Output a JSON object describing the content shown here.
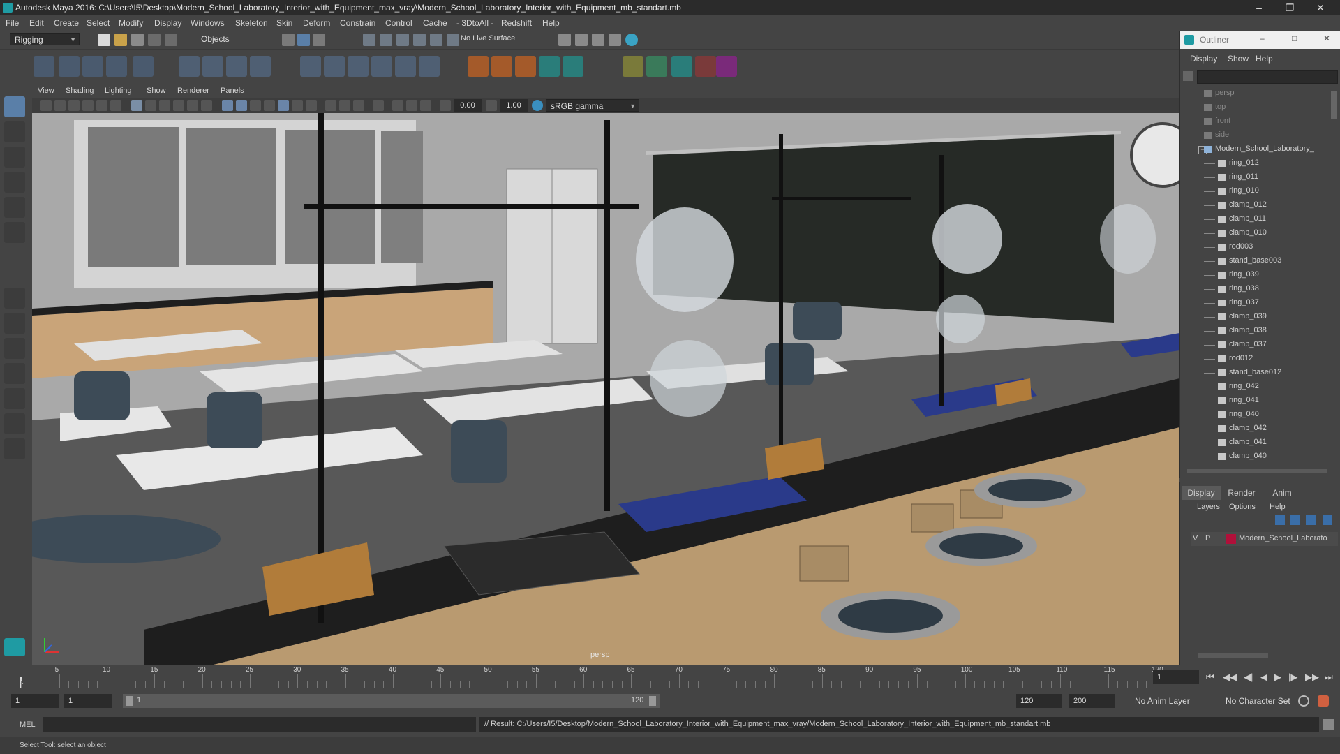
{
  "title_bar": {
    "title": "Autodesk Maya 2016: C:\\Users\\I5\\Desktop\\Modern_School_Laboratory_Interior_with_Equipment_max_vray\\Modern_School_Laboratory_Interior_with_Equipment_mb_standart.mb"
  },
  "menu": [
    "File",
    "Edit",
    "Create",
    "Select",
    "Modify",
    "Display",
    "Windows",
    "Skeleton",
    "Skin",
    "Deform",
    "Constrain",
    "Control",
    "Cache",
    "- 3DtoAll -",
    "Redshift",
    "Help"
  ],
  "status_line": {
    "menu_set": "Rigging",
    "selection_mode": "Objects",
    "live_surface": "No Live Surface"
  },
  "panel_menu": [
    "View",
    "Shading",
    "Lighting",
    "Show",
    "Renderer",
    "Panels"
  ],
  "panel_toolbar": {
    "exposure": "0.00",
    "gamma": "1.00",
    "color_space": "sRGB gamma"
  },
  "viewport": {
    "camera_label": "persp"
  },
  "outliner": {
    "title": "Outliner",
    "menu": [
      "Display",
      "Show",
      "Help"
    ],
    "items": [
      {
        "label": "persp",
        "kind": "camera"
      },
      {
        "label": "top",
        "kind": "camera"
      },
      {
        "label": "front",
        "kind": "camera"
      },
      {
        "label": "side",
        "kind": "camera"
      },
      {
        "label": "Modern_School_Laboratory_",
        "kind": "group"
      },
      {
        "label": "ring_012",
        "kind": "mesh"
      },
      {
        "label": "ring_011",
        "kind": "mesh"
      },
      {
        "label": "ring_010",
        "kind": "mesh"
      },
      {
        "label": "clamp_012",
        "kind": "mesh"
      },
      {
        "label": "clamp_011",
        "kind": "mesh"
      },
      {
        "label": "clamp_010",
        "kind": "mesh"
      },
      {
        "label": "rod003",
        "kind": "mesh"
      },
      {
        "label": "stand_base003",
        "kind": "mesh"
      },
      {
        "label": "ring_039",
        "kind": "mesh"
      },
      {
        "label": "ring_038",
        "kind": "mesh"
      },
      {
        "label": "ring_037",
        "kind": "mesh"
      },
      {
        "label": "clamp_039",
        "kind": "mesh"
      },
      {
        "label": "clamp_038",
        "kind": "mesh"
      },
      {
        "label": "clamp_037",
        "kind": "mesh"
      },
      {
        "label": "rod012",
        "kind": "mesh"
      },
      {
        "label": "stand_base012",
        "kind": "mesh"
      },
      {
        "label": "ring_042",
        "kind": "mesh"
      },
      {
        "label": "ring_041",
        "kind": "mesh"
      },
      {
        "label": "ring_040",
        "kind": "mesh"
      },
      {
        "label": "clamp_042",
        "kind": "mesh"
      },
      {
        "label": "clamp_041",
        "kind": "mesh"
      },
      {
        "label": "clamp_040",
        "kind": "mesh"
      }
    ]
  },
  "layer_editor": {
    "tabs": [
      "Display",
      "Render",
      "Anim"
    ],
    "menu": [
      "Layers",
      "Options",
      "Help"
    ],
    "layer": {
      "v": "V",
      "p": "P",
      "name": "Modern_School_Laborato",
      "color": "#b0103a"
    }
  },
  "timeline": {
    "ticks": [
      "5",
      "10",
      "15",
      "20",
      "25",
      "30",
      "35",
      "40",
      "45",
      "50",
      "55",
      "60",
      "65",
      "70",
      "75",
      "80",
      "85",
      "90",
      "95",
      "100",
      "105",
      "110",
      "115",
      "120"
    ],
    "start_marker": "1",
    "current_frame": "1"
  },
  "range": {
    "start": "1",
    "playback_start": "1",
    "range_start_label": "1",
    "range_end_label": "120",
    "playback_end": "120",
    "end": "200",
    "anim_layer": "No Anim Layer",
    "character_set": "No Character Set"
  },
  "command_line": {
    "lang": "MEL",
    "result": "// Result: C:/Users/I5/Desktop/Modern_School_Laboratory_Interior_with_Equipment_max_vray/Modern_School_Laboratory_Interior_with_Equipment_mb_standart.mb"
  },
  "help_line": {
    "text": "Select Tool: select an object"
  }
}
